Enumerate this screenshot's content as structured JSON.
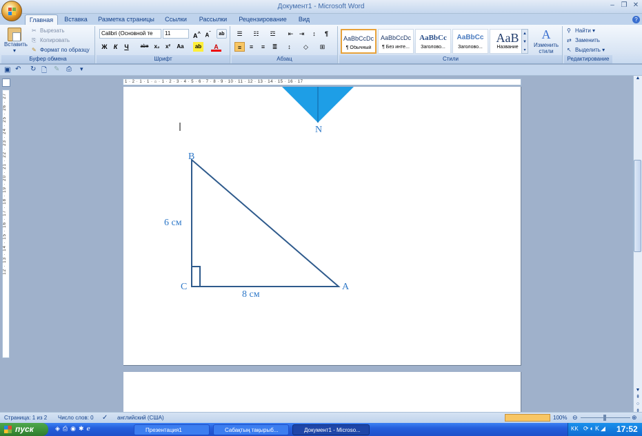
{
  "window": {
    "title": "Документ1 - Microsoft Word"
  },
  "tabs": [
    "Главная",
    "Вставка",
    "Разметка страницы",
    "Ссылки",
    "Рассылки",
    "Рецензирование",
    "Вид"
  ],
  "clipboard": {
    "paste": "Вставить",
    "cut": "Вырезать",
    "copy": "Копировать",
    "format_painter": "Формат по образцу",
    "label": "Буфер обмена"
  },
  "font": {
    "name": "Calibri (Основной те",
    "size": "11",
    "label": "Шрифт"
  },
  "paragraph": {
    "label": "Абзац"
  },
  "styles": {
    "items": [
      {
        "preview": "AaBbCcDc",
        "name": "¶ Обычный"
      },
      {
        "preview": "AaBbCcDc",
        "name": "¶ Без инте..."
      },
      {
        "preview": "AaBbCc",
        "name": "Заголово..."
      },
      {
        "preview": "AaBbCc",
        "name": "Заголово..."
      },
      {
        "preview": "AaB",
        "name": "Название"
      }
    ],
    "change": "Изменить стили",
    "label": "Стили"
  },
  "editing": {
    "find": "Найти",
    "replace": "Заменить",
    "select": "Выделить",
    "label": "Редактирование"
  },
  "ruler": {
    "horizontal": "1 · 2 · 1 · 1 · ⌂ · 1 · 2 · 3 · 4 · 5 · 6 · 7 · 8 · 9 · 10 · 11 · 12 · 13 · 14 · 15 · 16 · 17",
    "vertical": "12 · 13 · 14 · 15 · 16 · 17 · 18 · 19 · 20 · 21 · 22 · 23 · 24 · 25 · 26 · 27"
  },
  "document": {
    "vertex_top": "N",
    "vertex_b": "B",
    "vertex_c": "C",
    "vertex_a": "A",
    "side_bc": "6 см",
    "side_ca": "8 см"
  },
  "status": {
    "page": "Страница: 1 из 2",
    "words": "Число слов: 0",
    "language": "английский (США)",
    "zoom": "100%"
  },
  "taskbar": {
    "start": "пуск",
    "tasks": [
      "Презентация1",
      "Сабақтың тақырыб...",
      "Документ1 - Microso..."
    ],
    "lang": "KK",
    "time": "17:52"
  },
  "colors": {
    "figure": "#2e5a8c",
    "label": "#2e78c8",
    "accent_shape": "#1e9ee6"
  }
}
